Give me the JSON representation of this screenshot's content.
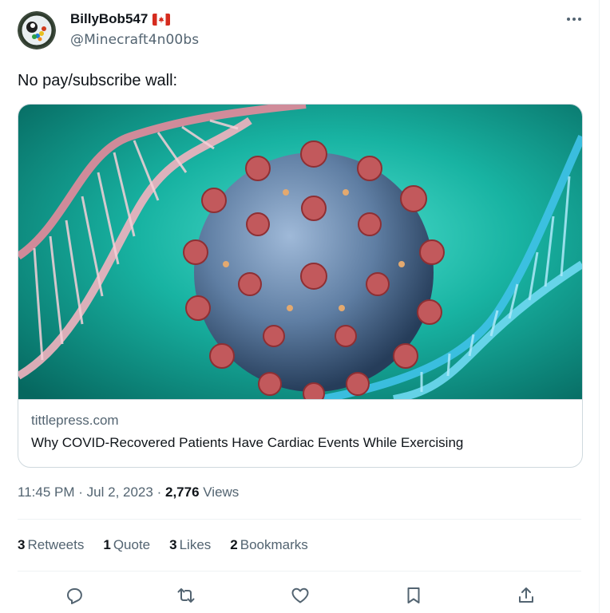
{
  "user": {
    "display_name": "BillyBob547",
    "flag": "canada-flag",
    "handle": "@Minecraft4n00bs"
  },
  "tweet": {
    "text": "No pay/subscribe wall:"
  },
  "card": {
    "domain": "tittlepress.com",
    "title": "Why COVID-Recovered Patients Have Cardiac Events While Exercising"
  },
  "meta": {
    "time": "11:45 PM",
    "sep1": "·",
    "date": "Jul 2, 2023",
    "sep2": "·",
    "views_count": "2,776",
    "views_label": "Views"
  },
  "stats": {
    "retweets_count": "3",
    "retweets_label": "Retweets",
    "quotes_count": "1",
    "quotes_label": "Quote",
    "likes_count": "3",
    "likes_label": "Likes",
    "bookmarks_count": "2",
    "bookmarks_label": "Bookmarks"
  },
  "icons": {
    "reply": "reply-icon",
    "retweet": "retweet-icon",
    "like": "heart-icon",
    "bookmark": "bookmark-icon",
    "share": "share-icon",
    "more": "more-icon"
  },
  "colors": {
    "text": "#0f1419",
    "secondary": "#536471",
    "border": "#cfd9de",
    "divider": "#eff3f4"
  }
}
